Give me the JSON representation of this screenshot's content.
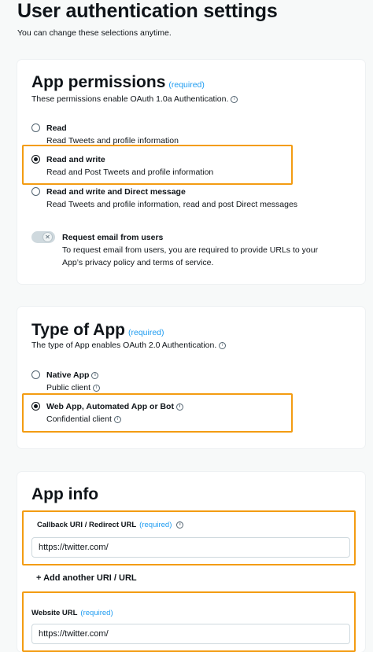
{
  "header": {
    "title": "User authentication settings",
    "subtitle": "You can change these selections anytime."
  },
  "permissions": {
    "title": "App permissions",
    "required": "(required)",
    "description": "These permissions enable OAuth 1.0a Authentication.",
    "options": [
      {
        "label": "Read",
        "desc": "Read Tweets and profile information",
        "selected": false
      },
      {
        "label": "Read and write",
        "desc": "Read and Post Tweets and profile information",
        "selected": true
      },
      {
        "label": "Read and write and Direct message",
        "desc": "Read Tweets and profile information, read and post Direct messages",
        "selected": false
      }
    ],
    "email_toggle": {
      "label": "Request email from users",
      "desc_line1": "To request email from users, you are required to provide URLs to your",
      "desc_line2": "App’s privacy policy and terms of service.",
      "on": false,
      "knob_glyph": "✕"
    }
  },
  "app_type": {
    "title": "Type of App",
    "required": "(required)",
    "description": "The type of App enables OAuth 2.0 Authentication.",
    "options": [
      {
        "label": "Native App",
        "desc": "Public client",
        "selected": false
      },
      {
        "label": "Web App, Automated App or Bot",
        "desc": "Confidential client",
        "selected": true
      }
    ]
  },
  "app_info": {
    "title": "App info",
    "callback": {
      "label": "Callback URI / Redirect URL",
      "required": "(required)",
      "value": "https://twitter.com/"
    },
    "add_uri": "+ Add another URI / URL",
    "website": {
      "label": "Website URL",
      "required": "(required)",
      "value": "https://twitter.com/"
    }
  },
  "icons": {
    "info": "ⓘ"
  },
  "colors": {
    "highlight": "#f39c12",
    "accent": "#1d9bf0"
  }
}
